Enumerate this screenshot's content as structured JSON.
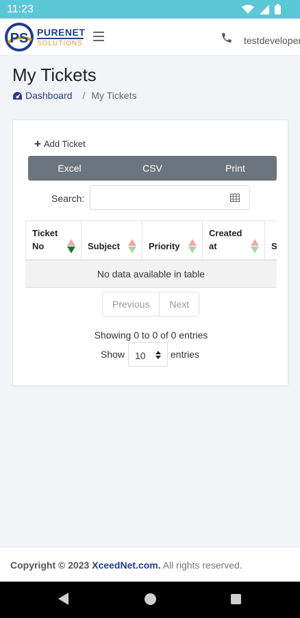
{
  "status_bar": {
    "time": "11:23",
    "icons": [
      "wifi-icon",
      "signal-icon",
      "battery-icon"
    ]
  },
  "header": {
    "brand_top": "PURENET",
    "brand_bottom": "SOLUTIONS",
    "logo_letters": "PS",
    "user": "testdeveloper",
    "icons": {
      "menu": "hamburger-icon",
      "phone": "phone-icon"
    }
  },
  "page": {
    "title": "My Tickets",
    "breadcrumb": {
      "home": "Dashboard",
      "separator": "/",
      "current": "My Tickets"
    }
  },
  "card": {
    "add_ticket": "Add Ticket",
    "export_buttons": [
      "Excel",
      "CSV",
      "Print"
    ],
    "search_label": "Search:",
    "search_value": "",
    "table": {
      "columns": [
        {
          "line1": "Ticket",
          "line2": "No",
          "sorted": "desc"
        },
        {
          "line1": "Subject",
          "line2": "",
          "sorted": "none"
        },
        {
          "line1": "Priority",
          "line2": "",
          "sorted": "none"
        },
        {
          "line1": "Created",
          "line2": "at",
          "sorted": "none"
        },
        {
          "line1": "S",
          "line2": "",
          "sorted": "none"
        }
      ],
      "empty_message": "No data available in table"
    },
    "pagination": {
      "previous": "Previous",
      "next": "Next"
    },
    "info": "Showing 0 to 0 of 0 entries",
    "length": {
      "show_label": "Show",
      "selected": "10",
      "entries_label": "entries"
    }
  },
  "footer": {
    "copyright": "Copyright © 2023",
    "company": "XceedNet.com.",
    "rights": "All rights reserved."
  },
  "colors": {
    "status_bar": "#5bc8d8",
    "brand": "#1d3d8f",
    "accent": "#e09a2a",
    "button_group": "#6c757d",
    "sort_active": "#157a2a"
  }
}
